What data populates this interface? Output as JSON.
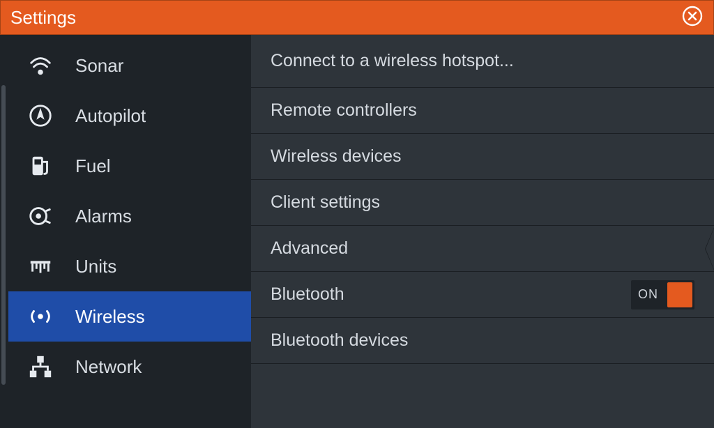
{
  "header": {
    "title": "Settings"
  },
  "sidebar": {
    "items": [
      {
        "label": "Sonar"
      },
      {
        "label": "Autopilot"
      },
      {
        "label": "Fuel"
      },
      {
        "label": "Alarms"
      },
      {
        "label": "Units"
      },
      {
        "label": "Wireless"
      },
      {
        "label": "Network"
      }
    ]
  },
  "content": {
    "rows": [
      {
        "label": "Connect to a wireless hotspot..."
      },
      {
        "label": "Remote controllers"
      },
      {
        "label": "Wireless devices"
      },
      {
        "label": "Client settings"
      },
      {
        "label": "Advanced"
      },
      {
        "label": "Bluetooth",
        "toggle_text": "ON"
      },
      {
        "label": "Bluetooth devices"
      }
    ]
  }
}
